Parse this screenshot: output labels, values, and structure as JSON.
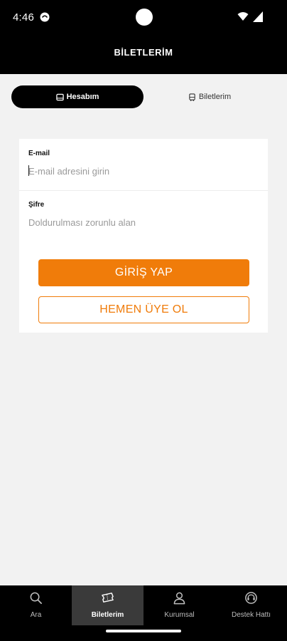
{
  "status_bar": {
    "time": "4:46"
  },
  "header": {
    "title": "BİLETLERİM"
  },
  "segments": [
    {
      "label": "Hesabım",
      "icon": "user-card-icon",
      "active": true
    },
    {
      "label": "Biletlerim",
      "icon": "bus-icon",
      "active": false
    }
  ],
  "form": {
    "email_label": "E-mail",
    "email_placeholder": "E-mail adresini girin",
    "email_value": "",
    "password_label": "Şifre",
    "password_placeholder": "Doldurulması zorunlu alan",
    "password_value": "",
    "login_label": "GİRİŞ YAP",
    "register_label": "HEMEN ÜYE OL"
  },
  "bottom_nav": {
    "items": [
      {
        "label": "Ara",
        "icon": "search-icon",
        "active": false
      },
      {
        "label": "Biletlerim",
        "icon": "ticket-icon",
        "active": true
      },
      {
        "label": "Kurumsal",
        "icon": "person-icon",
        "active": false
      },
      {
        "label": "Destek Hattı",
        "icon": "support-icon",
        "active": false
      }
    ]
  },
  "colors": {
    "accent": "#f07c0a",
    "header_bg": "#000000",
    "page_bg": "#f2f2f2"
  }
}
